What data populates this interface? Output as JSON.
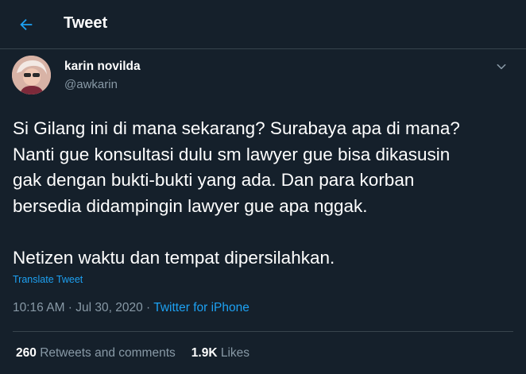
{
  "header": {
    "title": "Tweet",
    "back_icon": "back-arrow-icon"
  },
  "author": {
    "name": "karin novilda",
    "handle": "@awkarin"
  },
  "tweet": {
    "text": "Si Gilang ini di mana sekarang? Surabaya apa di mana?\nNanti gue konsultasi dulu sm lawyer gue bisa dikasusin\ngak dengan bukti-bukti yang ada. Dan para korban\nbersedia didampingin lawyer gue apa nggak.\n\nNetizen waktu dan tempat dipersilahkan.",
    "translate_label": "Translate Tweet",
    "time": "10:16 AM",
    "separator": " · ",
    "date": "Jul 30, 2020",
    "source": "Twitter for iPhone"
  },
  "stats": {
    "retweets_count": "260",
    "retweets_label": "Retweets and comments",
    "likes_count": "1.9K",
    "likes_label": "Likes"
  },
  "colors": {
    "background": "#15202b",
    "accent": "#1da1f2",
    "muted": "#8899a6",
    "divider": "#38444d"
  }
}
